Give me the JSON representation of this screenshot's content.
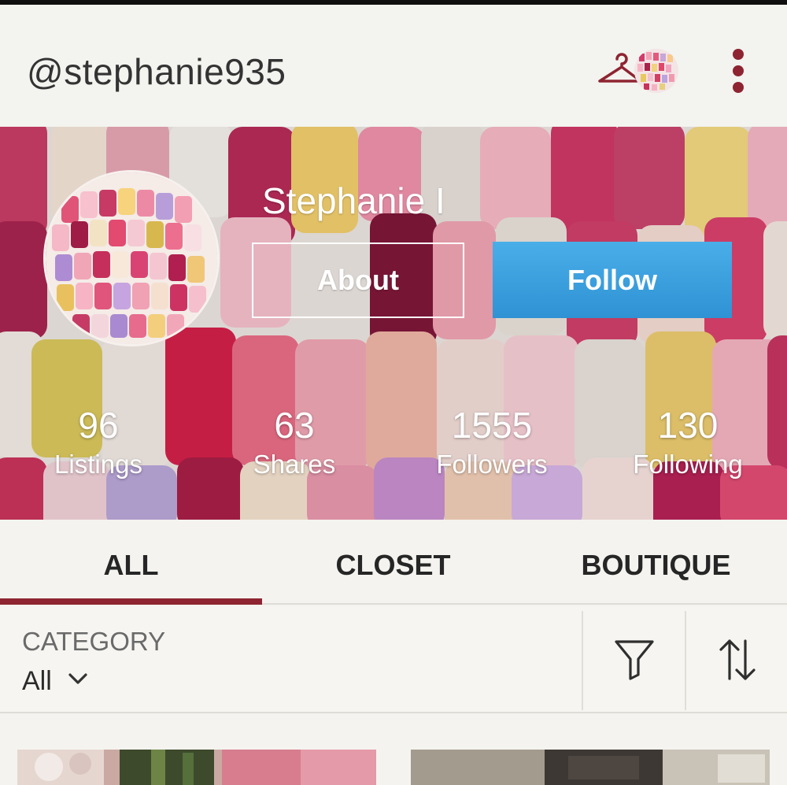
{
  "header": {
    "username": "@stephanie935",
    "icons": [
      "hanger-icon",
      "avatar",
      "more-vert-icon"
    ],
    "accent_color": "#8e2431"
  },
  "profile": {
    "name": "Stephanie I",
    "about_label": "About",
    "follow_label": "Follow",
    "follow_color": "#3a9fdf"
  },
  "stats": [
    {
      "value": "96",
      "label": "Listings"
    },
    {
      "value": "63",
      "label": "Shares"
    },
    {
      "value": "1555",
      "label": "Followers"
    },
    {
      "value": "130",
      "label": "Following"
    }
  ],
  "tabs": {
    "items": [
      {
        "label": "ALL",
        "selected": true
      },
      {
        "label": "CLOSET",
        "selected": false
      },
      {
        "label": "BOUTIQUE",
        "selected": false
      }
    ]
  },
  "filter": {
    "category_label": "CATEGORY",
    "category_value": "All",
    "icons": [
      "chevron-down-icon",
      "filter-icon",
      "sort-icon"
    ]
  }
}
